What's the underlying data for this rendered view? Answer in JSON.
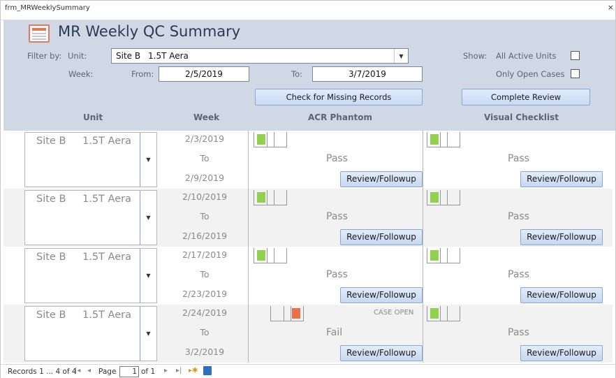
{
  "window": {
    "title": "frm_MRWeeklySummary",
    "close_glyph": "×"
  },
  "header": {
    "title": "MR Weekly QC Summary",
    "filter_label": "Filter by:",
    "unit_label": "Unit:",
    "unit_site": "Site B",
    "unit_model": "1.5T Aera",
    "week_label": "Week:",
    "from_label": "From:",
    "from_value": "2/5/2019",
    "to_label": "To:",
    "to_value": "3/7/2019",
    "show_label": "Show:",
    "all_active_label": "All Active Units",
    "all_active_checked": false,
    "open_cases_label": "Only Open Cases",
    "open_cases_checked": false,
    "check_missing_label": "Check for Missing Records",
    "complete_review_label": "Complete Review"
  },
  "columns": {
    "unit": "Unit",
    "week": "Week",
    "acr": "ACR Phantom",
    "visual": "Visual Checklist"
  },
  "colors": {
    "pass": "#92d050",
    "fail": "#e8704a",
    "header_bg": "#cfd8e4"
  },
  "records": [
    {
      "site": "Site B",
      "model": "1.5T Aera",
      "week_start": "2/3/2019",
      "to": "To",
      "week_end": "2/9/2019",
      "acr_status": "Pass",
      "acr_result": "pass",
      "acr_case": "",
      "visual_status": "Pass",
      "visual_result": "pass",
      "review_label": "Review/Followup"
    },
    {
      "site": "Site B",
      "model": "1.5T Aera",
      "week_start": "2/10/2019",
      "to": "To",
      "week_end": "2/16/2019",
      "acr_status": "Pass",
      "acr_result": "pass",
      "acr_case": "",
      "visual_status": "Pass",
      "visual_result": "pass",
      "review_label": "Review/Followup"
    },
    {
      "site": "Site B",
      "model": "1.5T Aera",
      "week_start": "2/17/2019",
      "to": "To",
      "week_end": "2/23/2019",
      "acr_status": "Pass",
      "acr_result": "pass",
      "acr_case": "",
      "visual_status": "Pass",
      "visual_result": "pass",
      "review_label": "Review/Followup"
    },
    {
      "site": "Site B",
      "model": "1.5T Aera",
      "week_start": "2/24/2019",
      "to": "To",
      "week_end": "3/2/2019",
      "acr_status": "Fail",
      "acr_result": "fail",
      "acr_case": "CASE OPEN",
      "visual_status": "Pass",
      "visual_result": "pass",
      "review_label": "Review/Followup"
    }
  ],
  "nav": {
    "records_label": "Records 1 ... 4 of 4",
    "page_label": "Page",
    "page_value": "1",
    "of_label": "of 1",
    "first_icon": "first-record-icon",
    "prev_icon": "prev-record-icon",
    "next_icon": "next-record-icon",
    "last_icon": "last-record-icon",
    "new_icon": "new-record-icon",
    "save_icon": "save-icon"
  }
}
